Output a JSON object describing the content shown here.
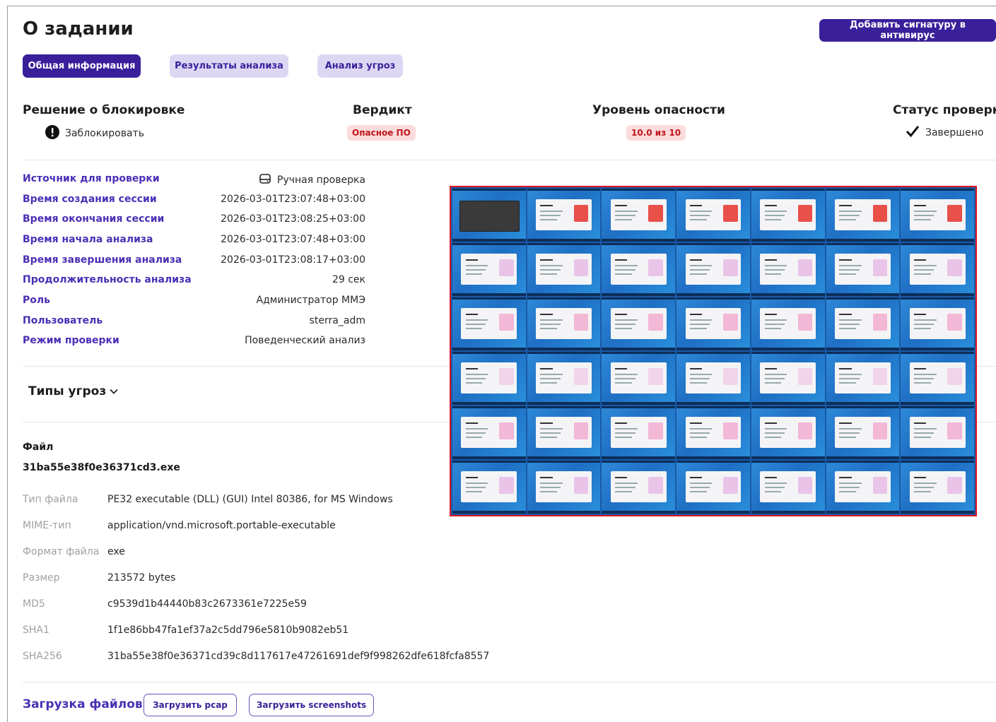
{
  "header": {
    "title": "О задании",
    "add_signature_label": "Добавить сигнатуру в антивирус"
  },
  "tabs": [
    {
      "label": "Общая информация",
      "active": true
    },
    {
      "label": "Результаты анализа",
      "active": false
    },
    {
      "label": "Анализ угроз",
      "active": false
    }
  ],
  "summary": {
    "block_decision": {
      "heading": "Решение о блокировке",
      "value": "Заблокировать"
    },
    "verdict": {
      "heading": "Вердикт",
      "value": "Опасное ПО"
    },
    "danger_level": {
      "heading": "Уровень опасности",
      "value": "10.0 из 10"
    },
    "check_status": {
      "heading": "Статус проверки",
      "value": "Завершено"
    }
  },
  "info": [
    {
      "label": "Источник для проверки",
      "value": "Ручная проверка"
    },
    {
      "label": "Время создания сессии",
      "value": "2026-03-01T23:07:48+03:00"
    },
    {
      "label": "Время окончания сессии",
      "value": "2026-03-01T23:08:25+03:00"
    },
    {
      "label": "Время начала анализа",
      "value": "2026-03-01T23:07:48+03:00"
    },
    {
      "label": "Время завершения анализа",
      "value": "2026-03-01T23:08:17+03:00"
    },
    {
      "label": "Продолжительность анализа",
      "value": "29 сек"
    },
    {
      "label": "Роль",
      "value": "Администратор ММЭ"
    },
    {
      "label": "Пользователь",
      "value": "sterra_adm"
    },
    {
      "label": "Режим проверки",
      "value": "Поведенческий анализ"
    }
  ],
  "threats": {
    "label": "Типы угроз"
  },
  "file": {
    "heading": "Файл",
    "name": "31ba55e38f0e36371cd3.exe",
    "props": [
      {
        "label": "Тип файла",
        "value": "PE32 executable (DLL) (GUI) Intel 80386, for MS Windows"
      },
      {
        "label": "MIME-тип",
        "value": "application/vnd.microsoft.portable-executable"
      },
      {
        "label": "Формат файла",
        "value": "exe"
      },
      {
        "label": "Размер",
        "value": "213572 bytes"
      },
      {
        "label": "MD5",
        "value": "c9539d1b44440b83c2673361e7225e59"
      },
      {
        "label": "SHA1",
        "value": "1f1e86bb47fa1ef37a2c5dd796e5810b9082eb51"
      },
      {
        "label": "SHA256",
        "value": "31ba55e38f0e36371cd39c8d117617e47261691def9f998262dfe618fcfa8557"
      }
    ]
  },
  "upload": {
    "label": "Загрузка файлов:",
    "pcap_label": "Загрузить pcap",
    "screenshots_label": "Загрузить screenshots"
  },
  "colors": {
    "accent": "#3a1f9a",
    "label": "#4a2fb5",
    "danger_bg": "#fbdcdc",
    "danger_text": "#c0141c",
    "screenshot_border": "#e0141c"
  },
  "icons": {
    "block_decision": "exclamation-circle-icon",
    "source": "hard-drive-icon",
    "status": "checkmark-icon",
    "threats_toggle": "chevron-down-icon"
  }
}
